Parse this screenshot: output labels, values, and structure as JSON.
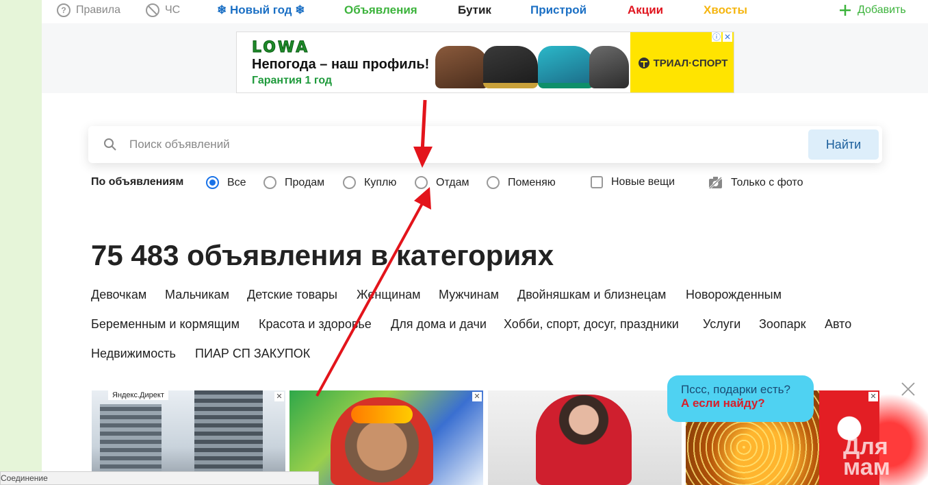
{
  "topnav": {
    "rules": "Правила",
    "blacklist": "ЧС",
    "newyear": "❄ Новый год ❄",
    "ads": "Объявления",
    "boutique": "Бутик",
    "pristroy": "Пристрой",
    "sales": "Акции",
    "tails": "Хвосты",
    "add": "Добавить"
  },
  "banner": {
    "logo": "LOWA",
    "headline": "Непогода – наш профиль!",
    "sub": "Гарантия 1 год",
    "brand": "ТРИАЛ·СПОРТ",
    "info_mark": "ⓘ",
    "close_mark": "✕"
  },
  "search": {
    "placeholder": "Поиск объявлений",
    "button": "Найти"
  },
  "filters": {
    "label": "По объявлениям",
    "options": [
      "Все",
      "Продам",
      "Куплю",
      "Отдам",
      "Поменяю"
    ],
    "selected": "Все",
    "new_items": "Новые вещи",
    "photo_only": "Только с фото"
  },
  "main": {
    "heading": "75 483 объявления в категориях",
    "categories": [
      "Девочкам",
      "Мальчикам",
      "Детские товары",
      "Женщинам",
      "Мужчинам",
      "Двойняшкам и близнецам",
      "Новорожденным",
      "Беременным и кормящим",
      "Красота и здоровье",
      "Для дома и дачи",
      "Хобби, спорт, досуг, праздники",
      "Услуги",
      "Зоопарк",
      "Авто",
      "Недвижимость",
      "ПИАР СП ЗАКУПОК"
    ]
  },
  "tiles": {
    "direct_label": "Яндекс.Директ",
    "close_mark": "✕"
  },
  "bubble": {
    "line1": "Пссс, подарки есть?",
    "line2": "А если найду?"
  },
  "watermark": "Для\nмам",
  "status": "Соединение",
  "colors": {
    "newyear": "#1a6fc4",
    "ads": "#3cb33c",
    "pristroy": "#1a6fc4",
    "sales": "#e0141e",
    "tails": "#f5b50f",
    "add": "#3cb33c",
    "accent": "#1a73e8",
    "arrow": "#e3141b"
  }
}
